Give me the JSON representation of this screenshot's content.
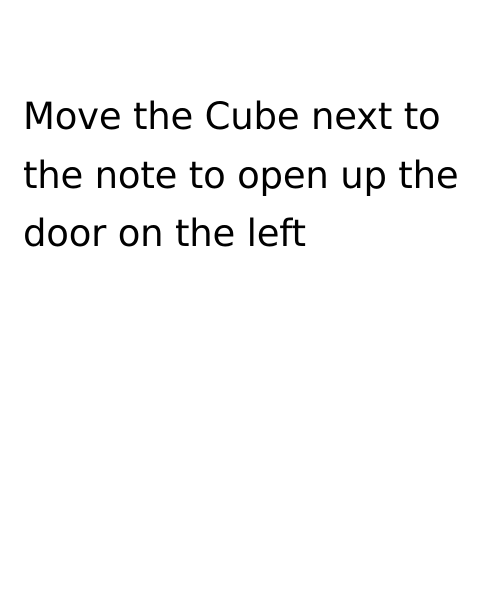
{
  "note": {
    "text": "Move the Cube next to the note to open up the door on the left",
    "text_color": "#000000",
    "background_color": "#ffffff"
  }
}
